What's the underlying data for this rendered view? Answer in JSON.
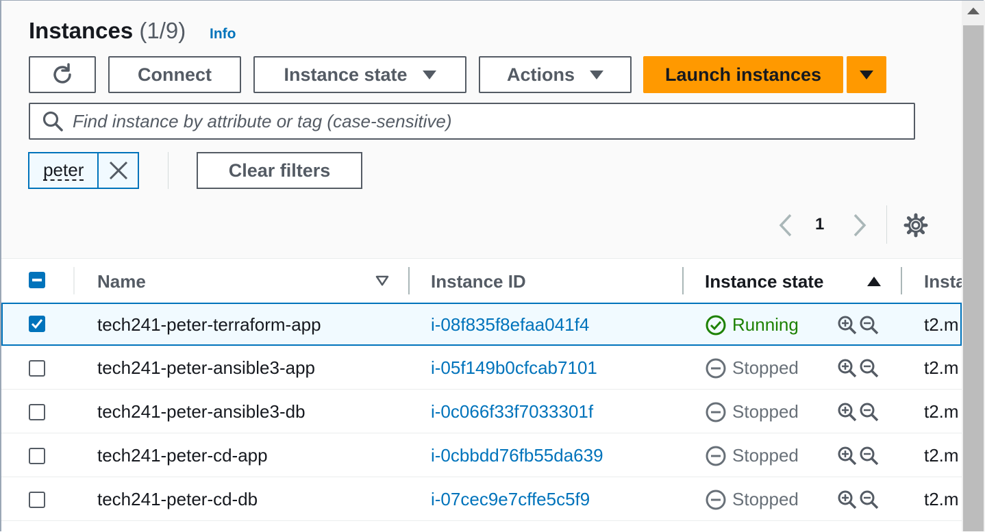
{
  "header": {
    "title": "Instances",
    "count": "(1/9)",
    "info_link": "Info"
  },
  "toolbar": {
    "connect_label": "Connect",
    "instance_state_label": "Instance state",
    "actions_label": "Actions",
    "launch_label": "Launch instances"
  },
  "search": {
    "placeholder": "Find instance by attribute or tag (case-sensitive)",
    "value": ""
  },
  "filter_token": {
    "label": "peter"
  },
  "clear_filters_label": "Clear filters",
  "pagination": {
    "current_page": "1"
  },
  "table": {
    "columns": [
      "Name",
      "Instance ID",
      "Instance state",
      "Insta"
    ],
    "rows": [
      {
        "name": "tech241-peter-terraform-app",
        "id": "i-08f835f8efaa041f4",
        "state": "Running",
        "type": "t2.m",
        "selected": true
      },
      {
        "name": "tech241-peter-ansible3-app",
        "id": "i-05f149b0cfcab7101",
        "state": "Stopped",
        "type": "t2.m",
        "selected": false
      },
      {
        "name": "tech241-peter-ansible3-db",
        "id": "i-0c066f33f7033301f",
        "state": "Stopped",
        "type": "t2.m",
        "selected": false
      },
      {
        "name": "tech241-peter-cd-app",
        "id": "i-0cbbdd76fb55da639",
        "state": "Stopped",
        "type": "t2.m",
        "selected": false
      },
      {
        "name": "tech241-peter-cd-db",
        "id": "i-07cec9e7cffe5c5f9",
        "state": "Stopped",
        "type": "t2.m",
        "selected": false
      }
    ]
  },
  "colors": {
    "primary": "#ff9900",
    "link": "#0073bb",
    "running": "#1d8102",
    "stopped": "#687078"
  }
}
